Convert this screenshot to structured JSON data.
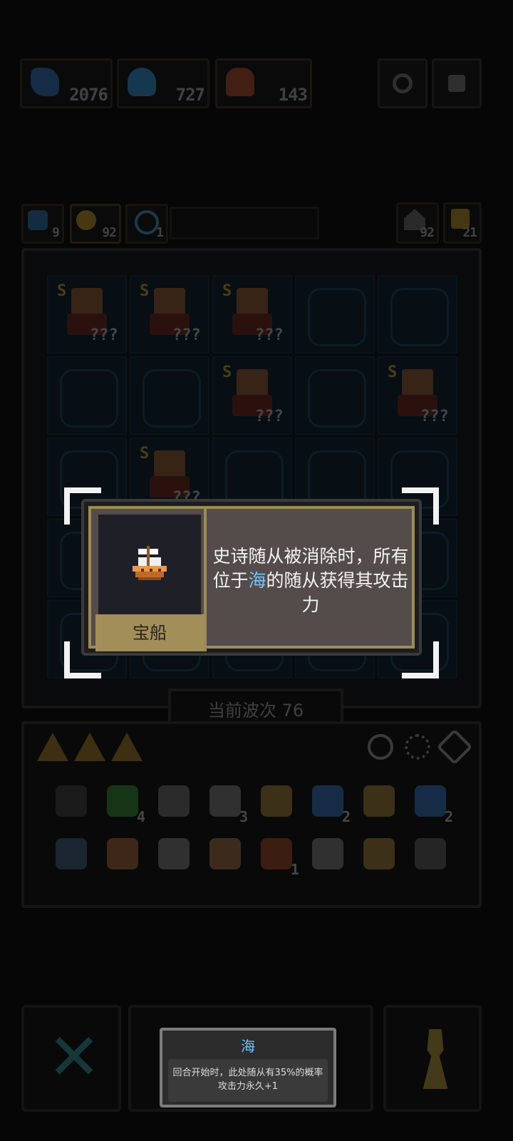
{
  "resources": [
    {
      "icon": "fish-icon",
      "value": "2076"
    },
    {
      "icon": "squid-icon",
      "value": "727"
    },
    {
      "icon": "hero-icon",
      "value": "143"
    }
  ],
  "top_buttons": [
    "gear-icon",
    "settings-icon"
  ],
  "status_row": {
    "left": [
      {
        "icon": "wave-icon",
        "value": "9"
      },
      {
        "icon": "coin-icon",
        "value": "92"
      },
      {
        "icon": "clock-icon",
        "value": "1"
      }
    ],
    "right": [
      {
        "icon": "house-icon",
        "value": "92"
      },
      {
        "icon": "shoe-icon",
        "value": "21"
      }
    ]
  },
  "board": {
    "unit_rank": "S",
    "unit_power": "???"
  },
  "wave": {
    "label": "当前波次",
    "value": "76"
  },
  "tray_slots": 3,
  "items_row1": [
    {
      "icon": "shield-icon",
      "count": ""
    },
    {
      "icon": "gem-icon",
      "count": "4"
    },
    {
      "icon": "hammer-icon",
      "count": ""
    },
    {
      "icon": "cloud-icon",
      "count": "3"
    },
    {
      "icon": "ship-icon",
      "count": ""
    },
    {
      "icon": "fish-icon",
      "count": "2"
    },
    {
      "icon": "chain-icon",
      "count": ""
    },
    {
      "icon": "crystal-icon",
      "count": "2"
    }
  ],
  "items_row2": [
    {
      "icon": "door-icon",
      "count": ""
    },
    {
      "icon": "cow-icon",
      "count": ""
    },
    {
      "icon": "anvil-icon",
      "count": ""
    },
    {
      "icon": "finger-icon",
      "count": ""
    },
    {
      "icon": "hero-icon",
      "count": "1"
    },
    {
      "icon": "boot-icon",
      "count": ""
    },
    {
      "icon": "cloak-icon",
      "count": ""
    },
    {
      "icon": "sword-icon",
      "count": ""
    }
  ],
  "popup": {
    "name": "宝船",
    "desc_part1": "史诗随从被消除时，所有位于",
    "desc_highlight": "海",
    "desc_part2": "的随从获得其攻击力",
    "highlight_color": "#6fc3ff"
  },
  "tooltip": {
    "title": "海",
    "line1": "回合开始时，此处随从有35%的概率",
    "line2": "攻击力永久+1"
  }
}
